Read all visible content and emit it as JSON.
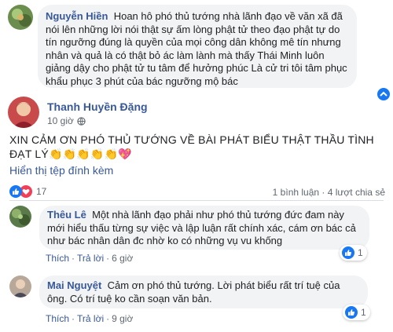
{
  "comments": [
    {
      "name": "Nguyễn Hiền",
      "text": "Hoan hô phó thủ tướng nhà lãnh đạo về văn xã đã nói lên những lời nói thật sự ấm lòng phật tử theo đạo phật tự do tín ngưỡng đúng là quyền của mọi công dân không mê tín nhưng nhân và quả là có thật bỏ ác làm lành mà thấy Thái Minh luôn giảng dậy cho phật tử tu tâm để hưởng phúc Là cử tri tôi tâm phục khẩu phục 3 phút của bác ngưỡng mộ bác"
    }
  ],
  "post": {
    "author": "Thanh Huyền Đặng",
    "time": "10 giờ",
    "text_line1": "XIN CẢM ƠN PHÓ THỦ TƯỚNG VỀ BÀI PHÁT BIỂU THẬT THẦU TÌNH",
    "text_line2": "ĐẠT LÝ👏👏👏👏👏💖",
    "translate_link": "Hiển thị tệp đính kèm",
    "reaction_count": "17",
    "stats": "1 bình luận · 4 lượt chia sẻ"
  },
  "replies": [
    {
      "name": "Thêu Lê",
      "text": "Một nhà lãnh đạo phải như phó thủ tướng đức đam này mới hiểu thấu từng sự việc và lập luận rất chính xác, cám ơn bác cả như bác nhân dân đc nhờ ko có những vụ vu khống",
      "like": "Thích",
      "reply": "Trả lời",
      "time": "6 giờ",
      "reaction_count": "1"
    },
    {
      "name": "Mai Nguyệt",
      "text": "Cảm ơn phó thủ tướng. Lời phát biểu rất trí tuệ của ông. Có trí tuệ ko cần soạn văn bản.",
      "like": "Thích",
      "reply": "Trả lời",
      "time": "9 giờ",
      "reaction_count": "1"
    }
  ],
  "colors": {
    "link": "#385898",
    "like_blue": "#1877f2",
    "love_red": "#f33e58",
    "bubble": "#f2f3f5"
  }
}
